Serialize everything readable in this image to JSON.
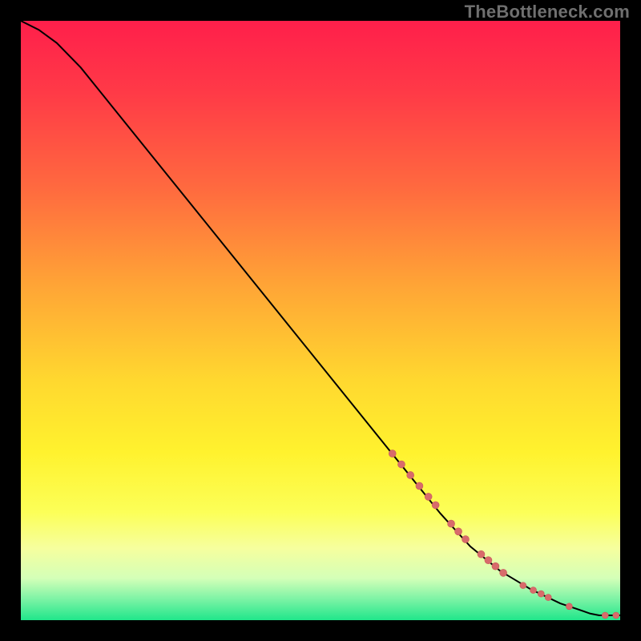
{
  "watermark": "TheBottleneck.com",
  "colors": {
    "gradient_stops": [
      {
        "offset": 0.0,
        "color": "#ff1f4b"
      },
      {
        "offset": 0.12,
        "color": "#ff3a47"
      },
      {
        "offset": 0.28,
        "color": "#ff6a3f"
      },
      {
        "offset": 0.44,
        "color": "#ffa436"
      },
      {
        "offset": 0.6,
        "color": "#ffd82f"
      },
      {
        "offset": 0.72,
        "color": "#fff22e"
      },
      {
        "offset": 0.82,
        "color": "#fcff58"
      },
      {
        "offset": 0.88,
        "color": "#f6ff9e"
      },
      {
        "offset": 0.93,
        "color": "#d4ffb8"
      },
      {
        "offset": 0.965,
        "color": "#7cf3a5"
      },
      {
        "offset": 1.0,
        "color": "#20e68b"
      }
    ],
    "curve": "#000000",
    "marker_fill": "#d86b6b",
    "marker_stroke": "#c95a5a",
    "background_outside": "#000000"
  },
  "chart_data": {
    "type": "line",
    "title": "",
    "xlabel": "",
    "ylabel": "",
    "xlim": [
      0,
      100
    ],
    "ylim": [
      0,
      100
    ],
    "grid": false,
    "legend": false,
    "series": [
      {
        "name": "curve",
        "x": [
          0,
          3,
          6,
          10,
          15,
          20,
          25,
          30,
          35,
          40,
          45,
          50,
          55,
          60,
          65,
          70,
          75,
          80,
          85,
          90,
          93,
          95,
          96.5,
          98,
          99,
          100
        ],
        "y": [
          100,
          98.5,
          96.3,
          92.2,
          86.0,
          79.8,
          73.6,
          67.4,
          61.2,
          55.0,
          48.8,
          42.6,
          36.4,
          30.2,
          24.0,
          17.8,
          12.3,
          8.2,
          5.2,
          2.8,
          1.8,
          1.1,
          0.8,
          0.8,
          0.8,
          0.8
        ]
      }
    ],
    "markers": [
      {
        "x": 62.0,
        "y": 27.8,
        "r": 4.5
      },
      {
        "x": 63.5,
        "y": 26.0,
        "r": 4.5
      },
      {
        "x": 65.0,
        "y": 24.2,
        "r": 4.5
      },
      {
        "x": 66.5,
        "y": 22.4,
        "r": 4.5
      },
      {
        "x": 68.0,
        "y": 20.6,
        "r": 4.5
      },
      {
        "x": 69.2,
        "y": 19.2,
        "r": 4.5
      },
      {
        "x": 71.8,
        "y": 16.1,
        "r": 4.5
      },
      {
        "x": 73.0,
        "y": 14.8,
        "r": 4.5
      },
      {
        "x": 74.2,
        "y": 13.5,
        "r": 4.5
      },
      {
        "x": 76.8,
        "y": 11.0,
        "r": 4.5
      },
      {
        "x": 78.0,
        "y": 10.0,
        "r": 4.5
      },
      {
        "x": 79.2,
        "y": 9.0,
        "r": 4.5
      },
      {
        "x": 80.5,
        "y": 7.9,
        "r": 4.5
      },
      {
        "x": 83.8,
        "y": 5.8,
        "r": 4.0
      },
      {
        "x": 85.5,
        "y": 5.0,
        "r": 4.0
      },
      {
        "x": 86.8,
        "y": 4.4,
        "r": 4.0
      },
      {
        "x": 88.0,
        "y": 3.8,
        "r": 4.0
      },
      {
        "x": 91.5,
        "y": 2.3,
        "r": 4.0
      },
      {
        "x": 97.5,
        "y": 0.8,
        "r": 4.0
      },
      {
        "x": 99.3,
        "y": 0.8,
        "r": 4.0
      }
    ]
  }
}
